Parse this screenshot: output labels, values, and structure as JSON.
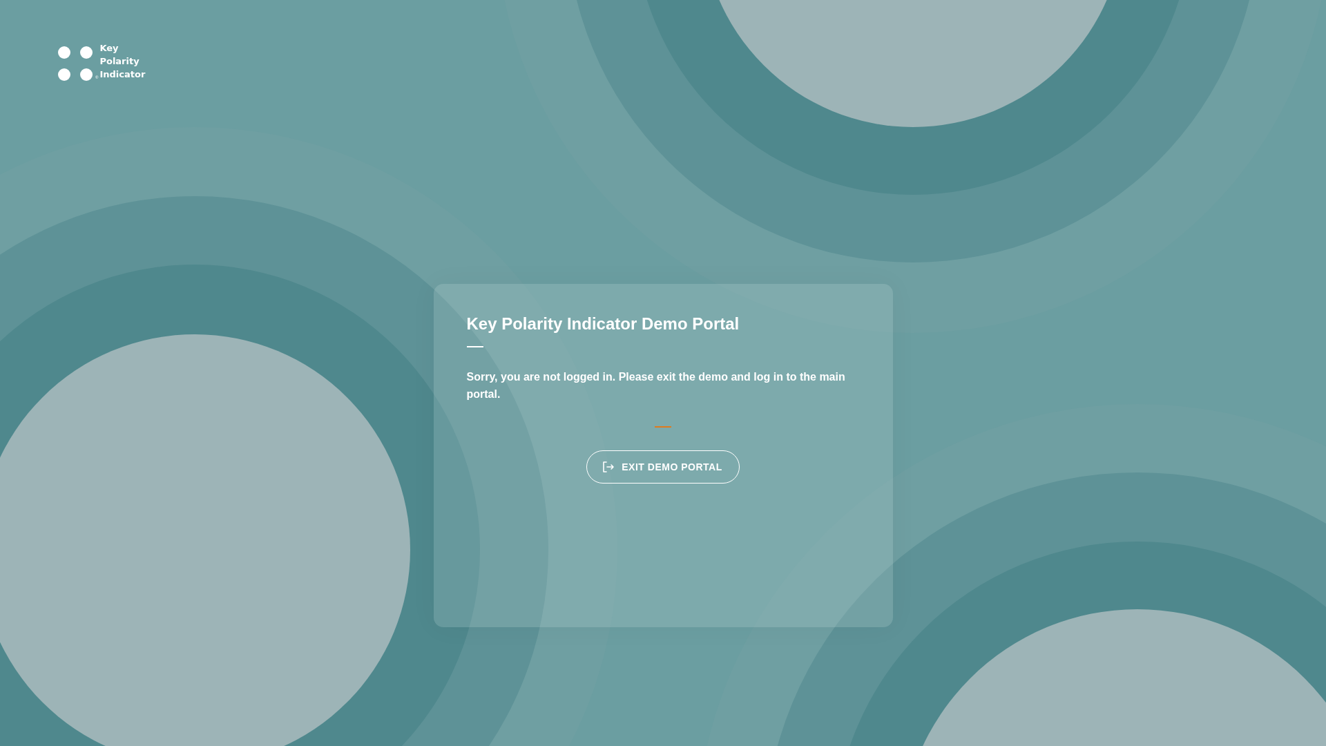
{
  "logo": {
    "wordmark": "Key Polarity Indicator",
    "registered_mark": "®"
  },
  "card": {
    "title": "Key Polarity Indicator Demo Portal",
    "message": "Sorry, you are not logged in. Please exit the demo and log in to the main portal.",
    "button": "EXIT DEMO PORTAL"
  }
}
